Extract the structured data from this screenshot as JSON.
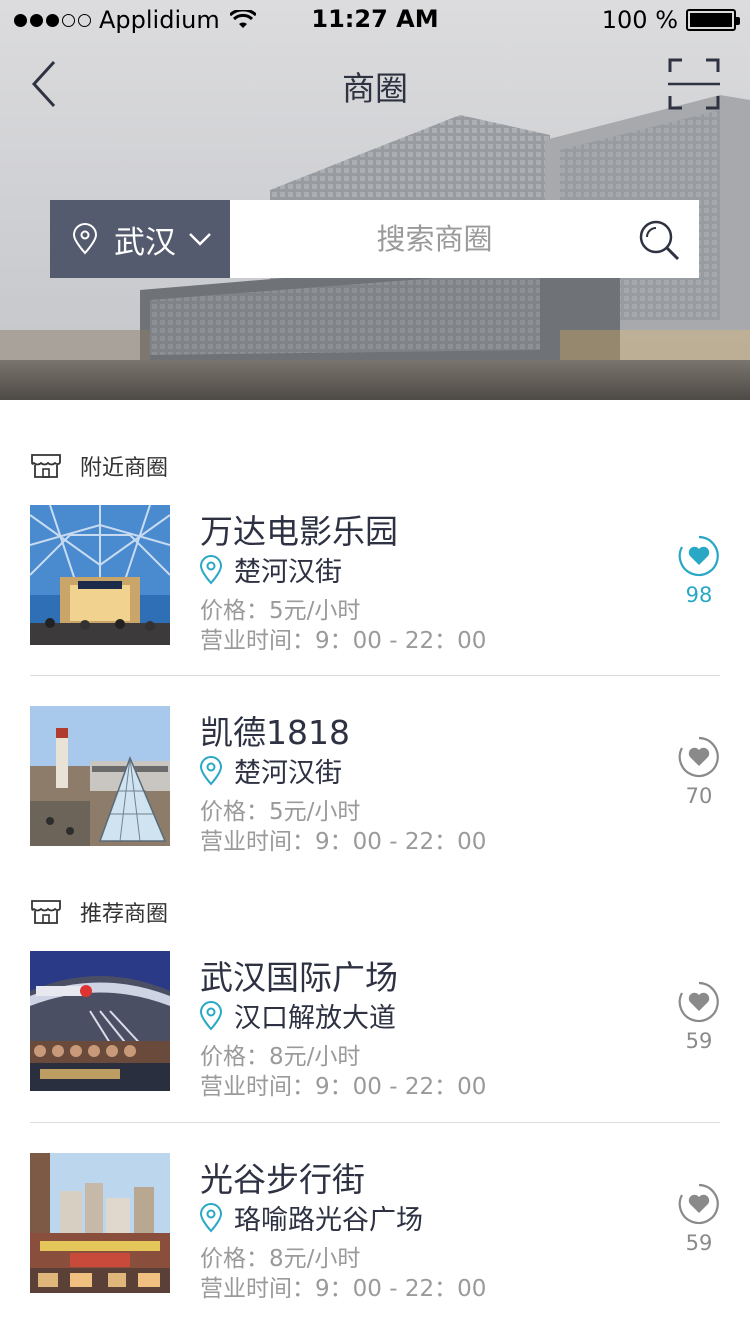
{
  "status_bar": {
    "carrier": "Applidium",
    "time": "11:27 AM",
    "battery": "100 %"
  },
  "nav": {
    "title": "商圈",
    "back_icon": "chevron-left-icon",
    "scan_icon": "scan-icon"
  },
  "search": {
    "city": "武汉",
    "placeholder": "搜索商圈"
  },
  "sections": [
    {
      "title": "附近商圈",
      "items": [
        {
          "name": "万达电影乐园",
          "location": "楚河汉街",
          "price": "价格：5元/小时",
          "hours": "营业时间：9：00 - 22：00",
          "favorites": "98",
          "favorited": true
        },
        {
          "name": "凯德1818",
          "location": "楚河汉街",
          "price": "价格：5元/小时",
          "hours": "营业时间：9：00 - 22：00",
          "favorites": "70",
          "favorited": false
        }
      ]
    },
    {
      "title": "推荐商圈",
      "items": [
        {
          "name": "武汉国际广场",
          "location": "汉口解放大道",
          "price": "价格：8元/小时",
          "hours": "营业时间：9：00 - 22：00",
          "favorites": "59",
          "favorited": false
        },
        {
          "name": "光谷步行街",
          "location": "珞喻路光谷广场",
          "price": "价格：8元/小时",
          "hours": "营业时间：9：00 - 22：00",
          "favorites": "59",
          "favorited": false
        }
      ]
    }
  ],
  "colors": {
    "accent": "#29a8c6",
    "city_button": "#555b6e",
    "title_text": "#2d3142",
    "muted_text": "#9a9a9a"
  }
}
